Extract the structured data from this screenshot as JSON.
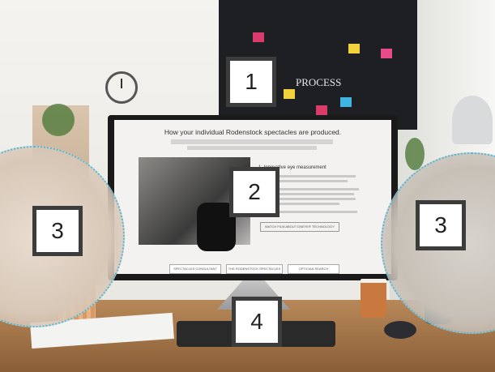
{
  "scene": {
    "screen_heading": "How your individual Rodenstock spectacles are produced.",
    "screen_section_title": "1. Innovative eye measurement",
    "screen_button": "WATCH FILM ABOUT DNEYE® TECHNOLOGY",
    "screen_nav": [
      "SPECTACLES CONSULTANT",
      "THE RODENSTOCK SPECTACLES",
      "OPTICIAN SEARCH"
    ],
    "blackboard_word": "PROCESS"
  },
  "labels": [
    {
      "id": "1",
      "text": "1"
    },
    {
      "id": "2",
      "text": "2"
    },
    {
      "id": "3a",
      "text": "3"
    },
    {
      "id": "3b",
      "text": "3"
    },
    {
      "id": "4",
      "text": "4"
    }
  ],
  "colors": {
    "dotted_circle": "#52b8d8",
    "label_border": "#3c3c3c"
  }
}
